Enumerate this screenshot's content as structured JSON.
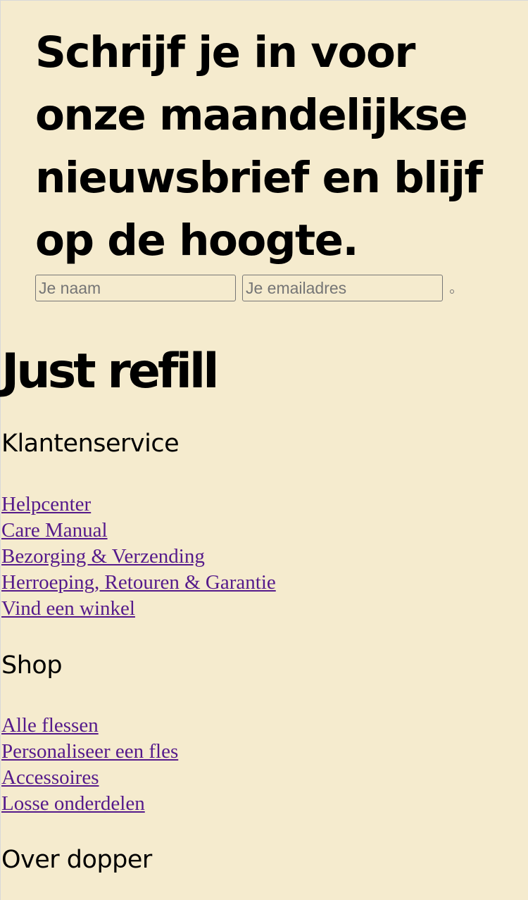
{
  "newsletter": {
    "heading_lines": [
      "Schrijf je in voor",
      "onze maandelijkse",
      "nieuwsbrief en blijf",
      "op de hoogte."
    ],
    "name_placeholder": "Je naam",
    "email_placeholder": "Je emailadres"
  },
  "footer": {
    "brand": "Just refill",
    "sections": [
      {
        "title": "Klantenservice",
        "links": [
          "Helpcenter",
          "Care Manual",
          "Bezorging & Verzending",
          "Herroeping, Retouren & Garantie",
          "Vind een winkel"
        ]
      },
      {
        "title": "Shop",
        "links": [
          "Alle flessen",
          "Personaliseer een fles",
          "Accessoires",
          "Losse onderdelen"
        ]
      },
      {
        "title": "Over dopper",
        "links": []
      }
    ]
  },
  "colors": {
    "background": "#F5EBCE",
    "link": "#551A8B",
    "text": "#000000"
  }
}
